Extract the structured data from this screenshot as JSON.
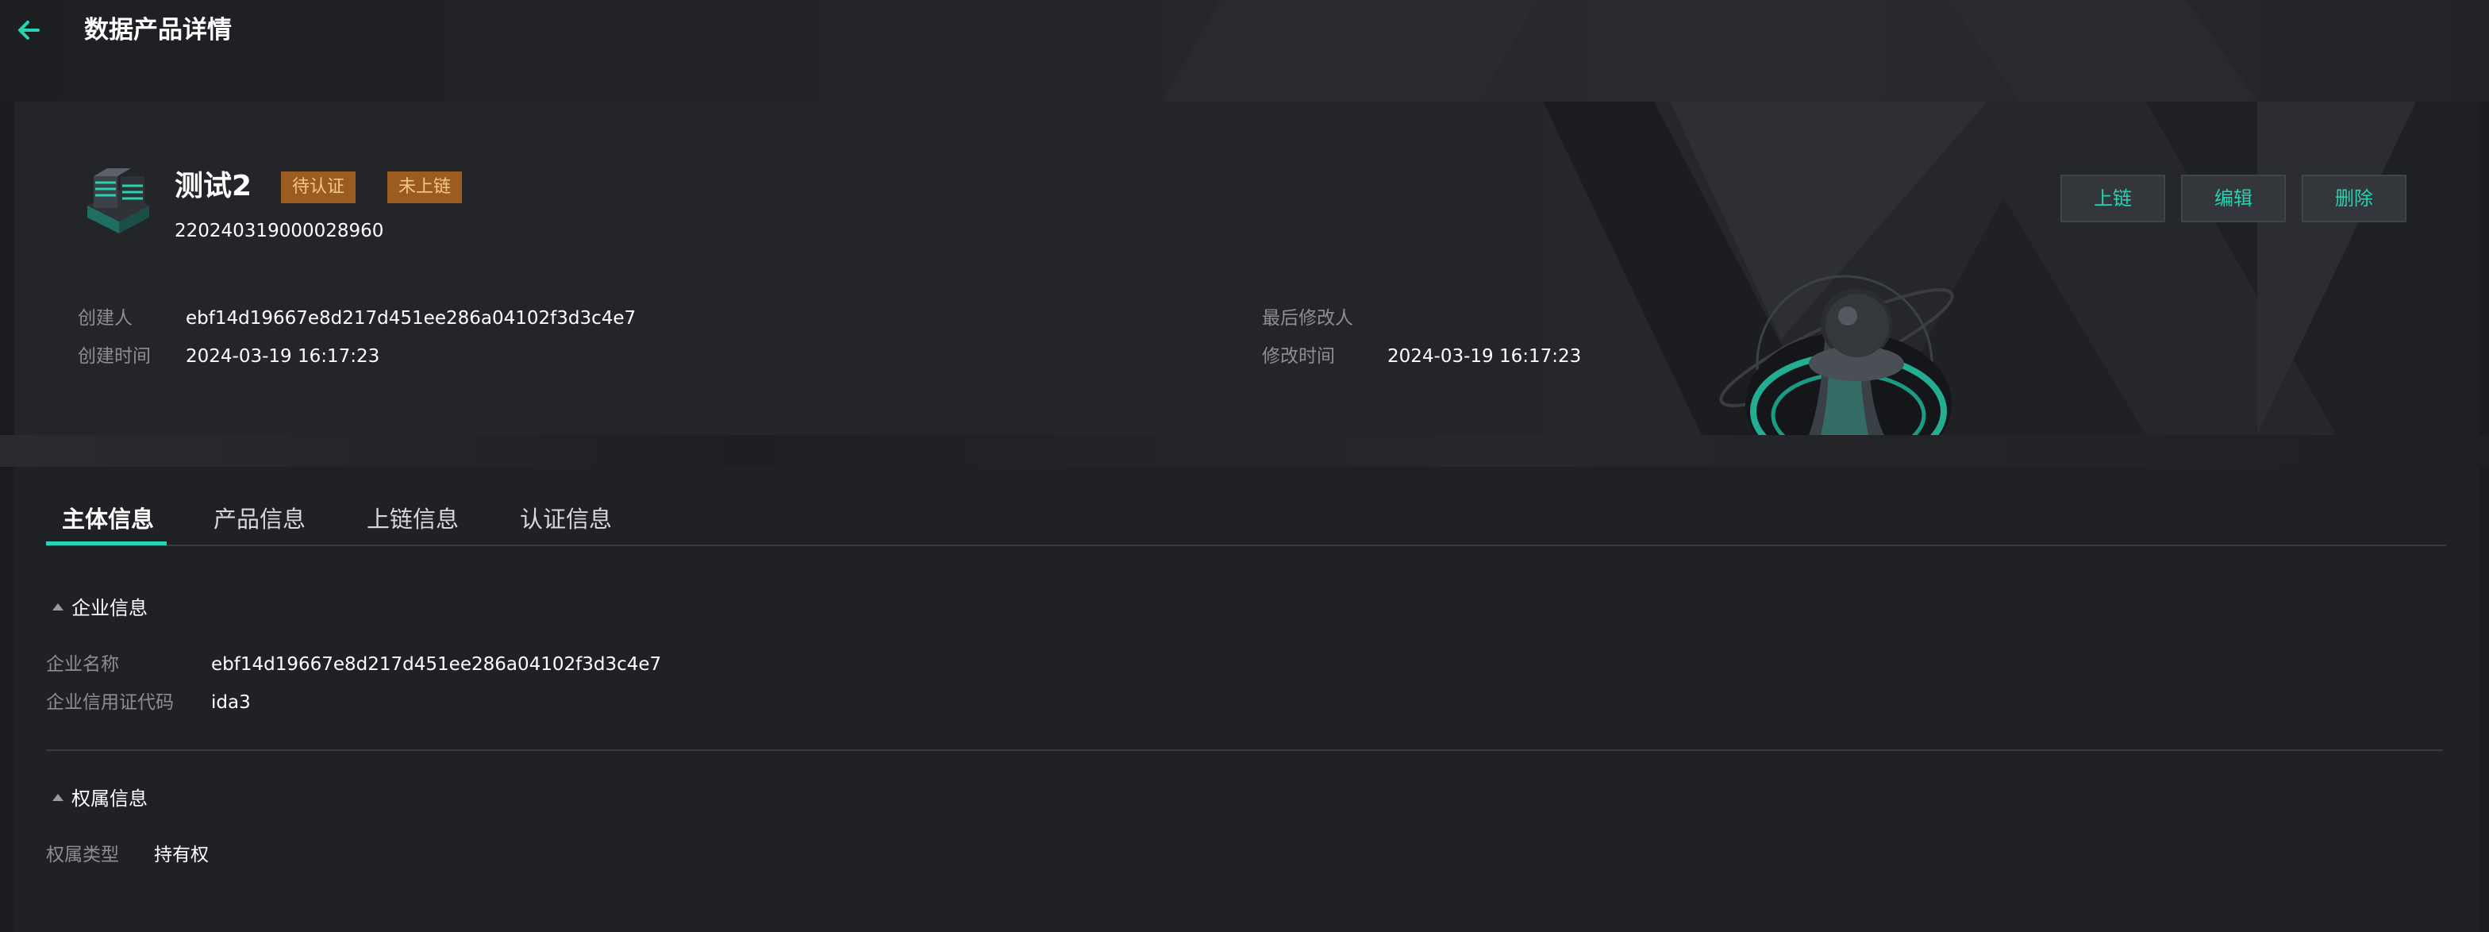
{
  "page": {
    "title": "数据产品详情"
  },
  "product": {
    "name": "测试2",
    "badges": [
      "待认证",
      "未上链"
    ],
    "id": "220240319000028960"
  },
  "actions": [
    "上链",
    "编辑",
    "删除"
  ],
  "meta": {
    "creator_label": "创建人",
    "creator_value": "ebf14d19667e8d217d451ee286a04102f3d3c4e7",
    "created_label": "创建时间",
    "created_value": "2024-03-19 16:17:23",
    "modifier_label": "最后修改人",
    "modifier_value": "",
    "modified_label": "修改时间",
    "modified_value": "2024-03-19 16:17:23"
  },
  "tabs": [
    "主体信息",
    "产品信息",
    "上链信息",
    "认证信息"
  ],
  "active_tab": "主体信息",
  "sections": {
    "enterprise": {
      "title": "企业信息",
      "fields": [
        {
          "label": "企业名称",
          "value": "ebf14d19667e8d217d451ee286a04102f3d3c4e7"
        },
        {
          "label": "企业信用证代码",
          "value": "ida3"
        }
      ]
    },
    "ownership": {
      "title": "权属信息",
      "fields": [
        {
          "label": "权属类型",
          "value": "持有权"
        }
      ]
    }
  },
  "colors": {
    "accent": "#27d3b2",
    "badge_bg": "#9b5c1f",
    "badge_text": "#f6c78a",
    "background": "#1b1c20"
  },
  "icons": {
    "back": "arrow-left-icon",
    "product": "stacked-cube-icon"
  }
}
